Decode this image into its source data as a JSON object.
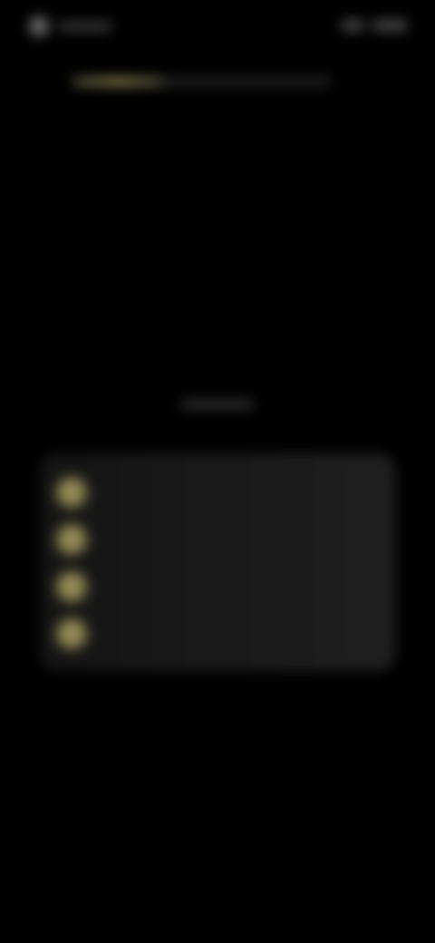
{
  "status_bar": {
    "left_indicator": "status-dot",
    "right_indicator": "status-pill"
  },
  "progress": {
    "value": 0.35,
    "accent": "#a79c5d",
    "track": "#2a2a2a"
  },
  "headline": {
    "text": "",
    "subtitle": ""
  },
  "benefits": {
    "icon": "check-icon",
    "badge_color": "#8d8450",
    "items": [
      {
        "label": ""
      },
      {
        "label": ""
      },
      {
        "label": ""
      },
      {
        "label": ""
      },
      {
        "label": ""
      }
    ]
  },
  "colors": {
    "background": "#000000",
    "card": "#1a1a1a",
    "text": "#eaeaea"
  }
}
